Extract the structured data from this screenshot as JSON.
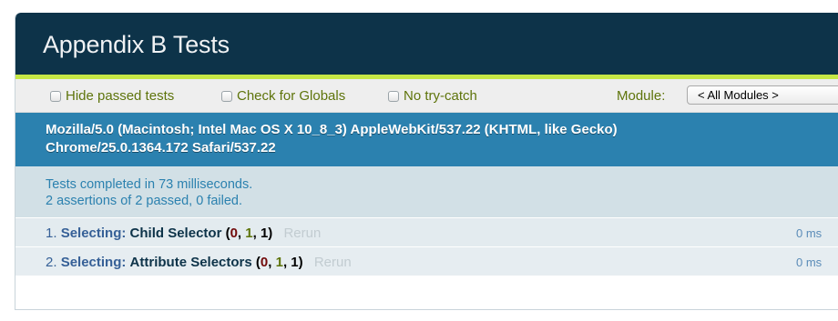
{
  "header": {
    "title": "Appendix B Tests"
  },
  "toolbar": {
    "hide_passed_label": "Hide passed tests",
    "check_globals_label": "Check for Globals",
    "no_try_catch_label": "No try-catch",
    "module_label": "Module:",
    "module_selected": "< All Modules >"
  },
  "useragent": {
    "line1": "Mozilla/5.0 (Macintosh; Intel Mac OS X 10_8_3) AppleWebKit/537.22 (KHTML, like Gecko)",
    "line2": "Chrome/25.0.1364.172 Safari/537.22"
  },
  "summary": {
    "line1": "Tests completed in 73 milliseconds.",
    "line2": "2 assertions of 2 passed, 0 failed."
  },
  "tests": [
    {
      "number": "1.",
      "module": "Selecting:",
      "name": "Child Selector",
      "failed": "0",
      "passed": "1",
      "total": "1",
      "rerun": "Rerun",
      "duration": "0 ms"
    },
    {
      "number": "2.",
      "module": "Selecting:",
      "name": "Attribute Selectors",
      "failed": "0",
      "passed": "1",
      "total": "1",
      "rerun": "Rerun",
      "duration": "0 ms"
    }
  ],
  "colors": {
    "header_bg": "#0d3349",
    "accent": "#c6e746",
    "useragent_bg": "#2b81af",
    "summary_bg": "#d2e0e6",
    "fail": "#710909",
    "pass": "#5e740b"
  }
}
